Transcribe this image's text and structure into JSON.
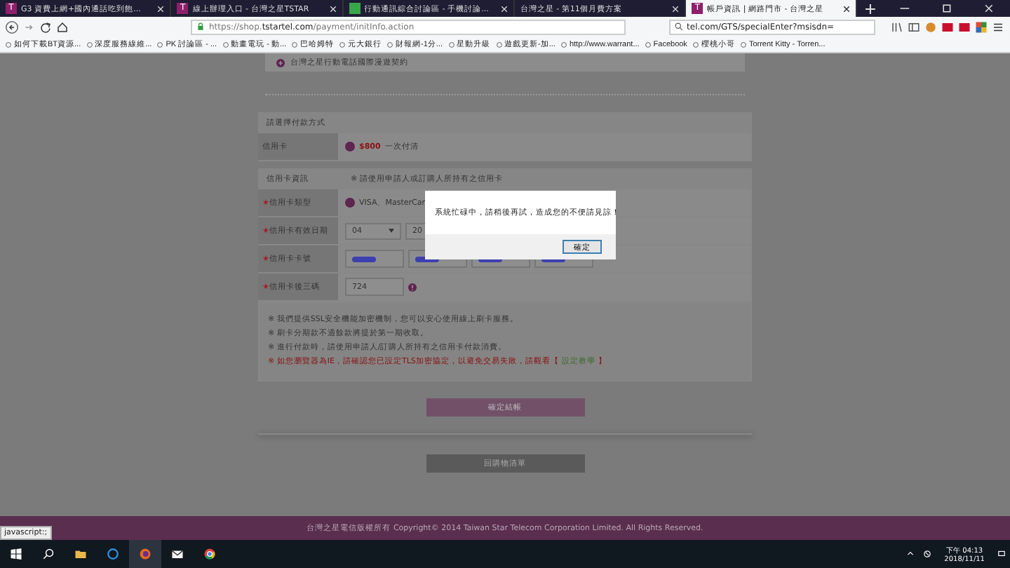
{
  "browser": {
    "tabs": [
      {
        "title": "G3 資費上網+國內通話吃到飽...",
        "icon_text": "T",
        "color": "#8e1f6a",
        "selected": false
      },
      {
        "title": "線上辦理入口 - 台灣之星TSTAR",
        "icon_text": "T",
        "color": "#8e1f6a",
        "selected": false
      },
      {
        "title": "行動通訊綜合討論區 - 手機討論...",
        "color": "#3aa64a",
        "selected": false
      },
      {
        "title": "台灣之星 - 第11個月費方案",
        "selected": false
      },
      {
        "title": "帳戶資訊 | 網路門市 - 台灣之星",
        "icon_text": "T",
        "color": "#8e1f6a",
        "selected": true
      }
    ],
    "url_prefix": "https://shop.",
    "url_domain": "tstartel.com",
    "url_path": "/payment/initInfo.action",
    "search_text": "tel.com/GTS/specialEnter?msisdn=",
    "bookmarks": [
      "如何下載BT資源...",
      "深度服務線維...",
      "PK 討論區 - ...",
      "動畫電玩 - 動...",
      "巴哈姆特",
      "元大銀行",
      "財報網-1分...",
      "星動升級",
      "遊戲更新-加...",
      "http://www.warrant...",
      "Facebook",
      "櫻桃小哥",
      "Torrent Kitty - Torren..."
    ]
  },
  "page": {
    "contract": "台灣之星行動電話國際漫遊契約",
    "payment_header": "請選擇付款方式",
    "payment_rows": [
      {
        "label": "信用卡",
        "amount": "$800",
        "text": "一次付清",
        "selected": true
      }
    ],
    "card_header": "信用卡資訊",
    "card_note": "※ 請使用申請人或訂購人所持有之信用卡",
    "fields": [
      {
        "kind": "radio",
        "mark": "★",
        "label": "信用卡類型",
        "value": "VISA、MasterCar",
        "selected": true
      },
      {
        "kind": "expiry",
        "mark": "★",
        "label": "信用卡有效日期",
        "month": "04",
        "year": "20"
      },
      {
        "kind": "card_number",
        "mark": "★",
        "label": "信用卡卡號"
      },
      {
        "kind": "cvv",
        "mark": "★",
        "label": "信用卡後三碼",
        "value": "724"
      }
    ],
    "notes": [
      {
        "kind": "normal",
        "text": "※ 我們提供SSL安全機能加密機制，您可以安心使用線上刷卡服務。"
      },
      {
        "kind": "normal",
        "text": "※ 刷卡分期款不適餘款將提於第一期收取。"
      },
      {
        "kind": "normal",
        "text": "※ 進行付款時，請使用申請人/訂購人所持有之信用卡付款消費。"
      },
      {
        "kind": "warning",
        "text": "※ 如您瀏覽器為IE，請確認您已設定TLS加密協定，以避免交易失敗，請觀看【",
        "link": "設定教學",
        "after": "】"
      }
    ],
    "confirm_button": "確定結帳",
    "back_button": "回購物清單",
    "footer": "台灣之星電信版權所有 Copyright© 2014 Taiwan Star Telecom Corporation Limited. All Rights Reserved."
  },
  "dialog": {
    "message": "系統忙碌中，請稍後再試，造成您的不便請見諒！",
    "button": "確定"
  },
  "status_text": "javascript:;",
  "taskbar": {
    "time": "下午 04:13",
    "date": "2018/11/11"
  }
}
